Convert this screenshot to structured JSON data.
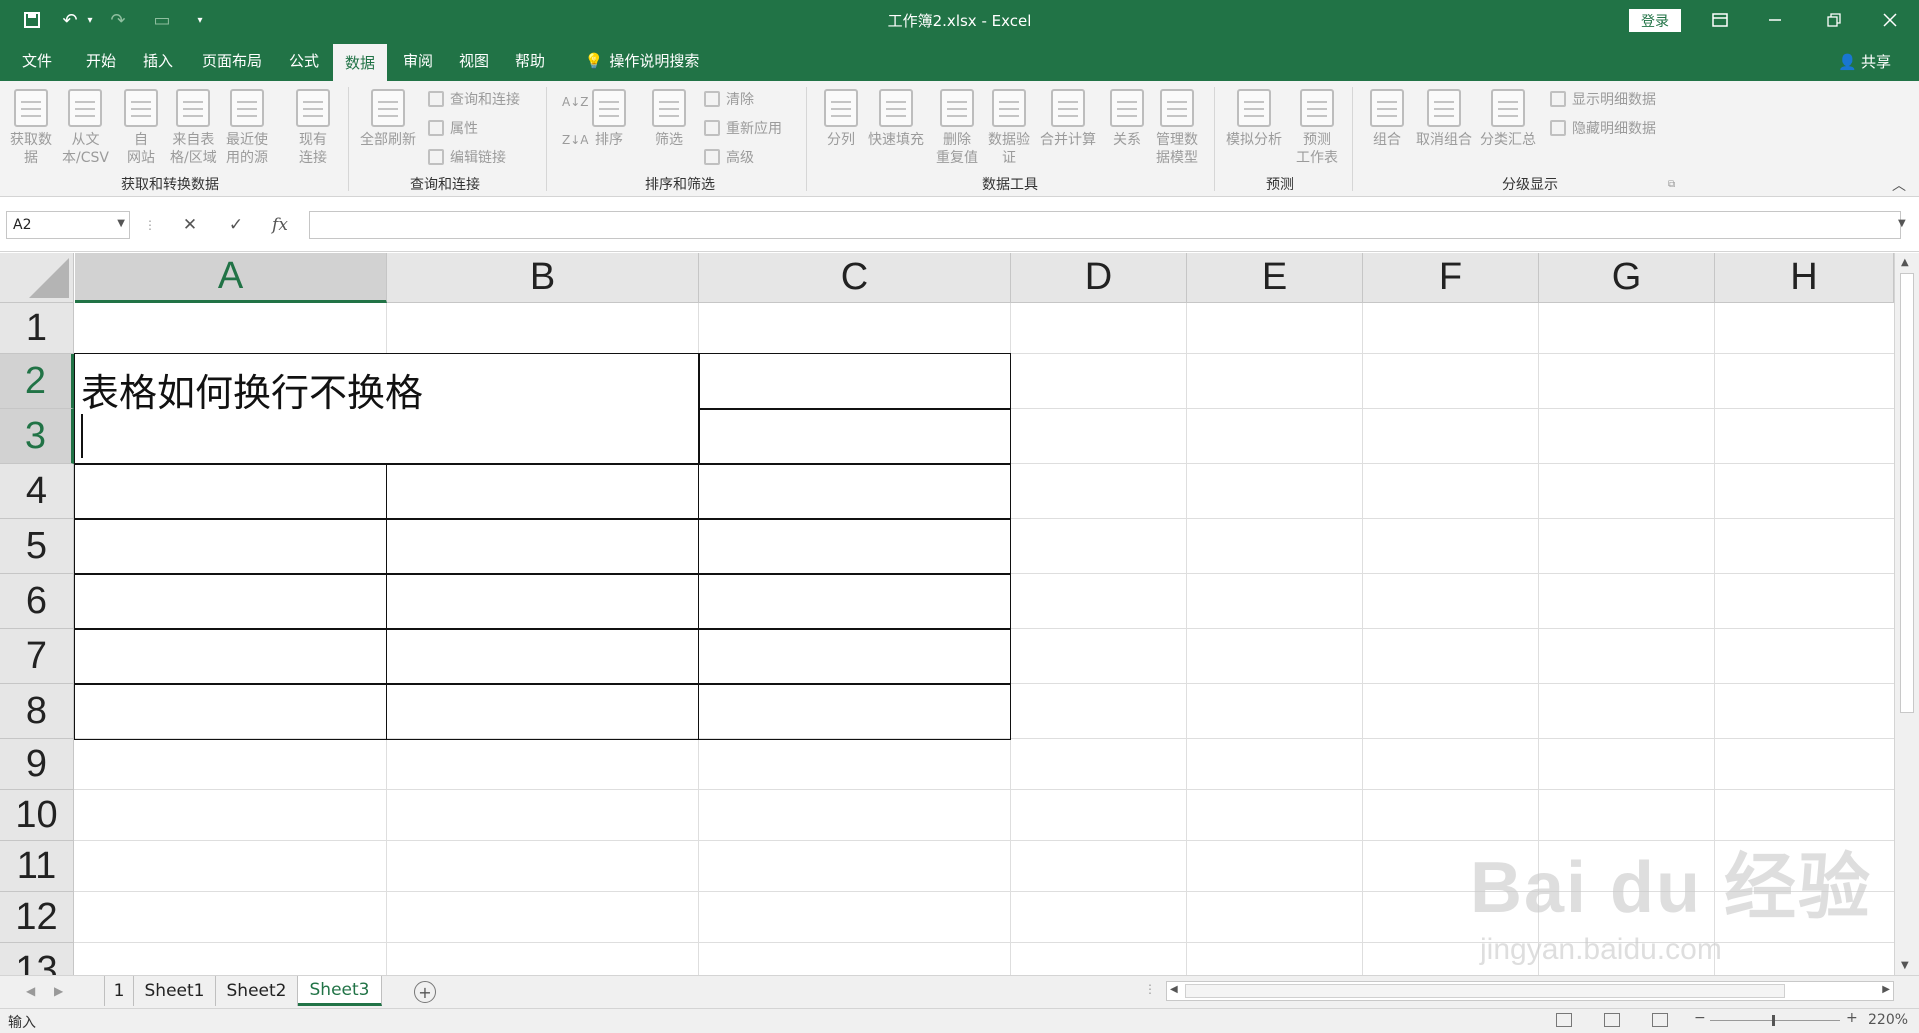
{
  "app": {
    "title": "工作簿2.xlsx  -  Excel",
    "login": "登录"
  },
  "quick_access": [
    "save-icon",
    "undo-icon",
    "redo-icon",
    "touch-mode-icon",
    "customize-icon"
  ],
  "window_controls": [
    "ribbon-display-icon",
    "minimize-icon",
    "restore-icon",
    "close-icon"
  ],
  "tabs": [
    {
      "label": "文件"
    },
    {
      "label": "开始"
    },
    {
      "label": "插入"
    },
    {
      "label": "页面布局"
    },
    {
      "label": "公式"
    },
    {
      "label": "数据"
    },
    {
      "label": "审阅"
    },
    {
      "label": "视图"
    },
    {
      "label": "帮助"
    },
    {
      "label": "操作说明搜索"
    }
  ],
  "share": "共享",
  "ribbon": {
    "groups": [
      {
        "label": "获取和转换数据"
      },
      {
        "label": "查询和连接"
      },
      {
        "label": "排序和筛选"
      },
      {
        "label": "数据工具"
      },
      {
        "label": "预测"
      },
      {
        "label": "分级显示"
      }
    ],
    "buttons": {
      "get_data": "获取数\n据",
      "from_text": "从文\n本/CSV",
      "from_web": "自\n网站",
      "from_table": "来自表\n格/区域",
      "recent_sources": "最近使\n用的源",
      "existing_conn": "现有\n连接",
      "refresh_all": "全部刷新",
      "query_conn": "查询和连接",
      "properties": "属性",
      "edit_links": "编辑链接",
      "sort": "排序",
      "filter": "筛选",
      "clear": "清除",
      "reapply": "重新应用",
      "advanced": "高级",
      "text_to_cols": "分列",
      "flash_fill": "快速填充",
      "remove_dup": "删除\n重复值",
      "validation": "数据验\n证",
      "consolidate": "合并计算",
      "relations": "关系",
      "data_model": "管理数\n据模型",
      "whatif": "模拟分析",
      "forecast": "预测\n工作表",
      "group": "组合",
      "ungroup": "取消组合",
      "subtotal": "分类汇总",
      "show_detail": "显示明细数据",
      "hide_detail": "隐藏明细数据"
    }
  },
  "formula_bar": {
    "name_box": "A2",
    "fx": "fx",
    "value": ""
  },
  "grid": {
    "columns": [
      "A",
      "B",
      "C",
      "D",
      "E",
      "F",
      "G",
      "H"
    ],
    "rows": [
      "1",
      "2",
      "3",
      "4",
      "5",
      "6",
      "7",
      "8",
      "9",
      "10",
      "11",
      "12",
      "13"
    ],
    "selected_column": "A",
    "selected_rows": [
      "2",
      "3"
    ],
    "cell_a2": "表格如何换行不换格"
  },
  "sheets": [
    {
      "label": "1"
    },
    {
      "label": "Sheet1"
    },
    {
      "label": "Sheet2"
    },
    {
      "label": "Sheet3"
    }
  ],
  "active_sheet": "Sheet3",
  "status": {
    "mode": "输入",
    "zoom": "220%"
  },
  "watermark": {
    "brand": "Bai du 经验",
    "url": "jingyan.baidu.com"
  },
  "colors": {
    "accent": "#217346"
  }
}
